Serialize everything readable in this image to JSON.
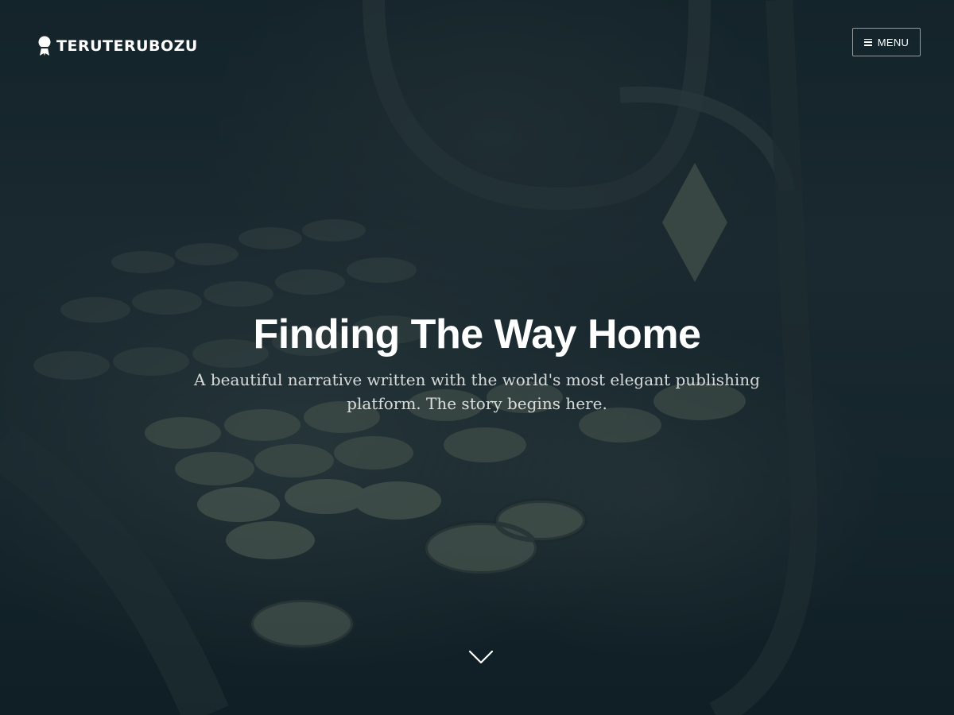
{
  "header": {
    "logo_text": "TERUTERUBOZU",
    "menu_label": "MENU"
  },
  "hero": {
    "title": "Finding The Way Home",
    "description": "A beautiful narrative written with the world's most elegant publishing platform. The story begins here."
  },
  "icons": {
    "logo": "teru-teru-bozu-icon",
    "menu": "hamburger-icon",
    "scroll": "chevron-down-icon"
  },
  "colors": {
    "overlay": "#0a1c24",
    "text": "#ffffff"
  }
}
